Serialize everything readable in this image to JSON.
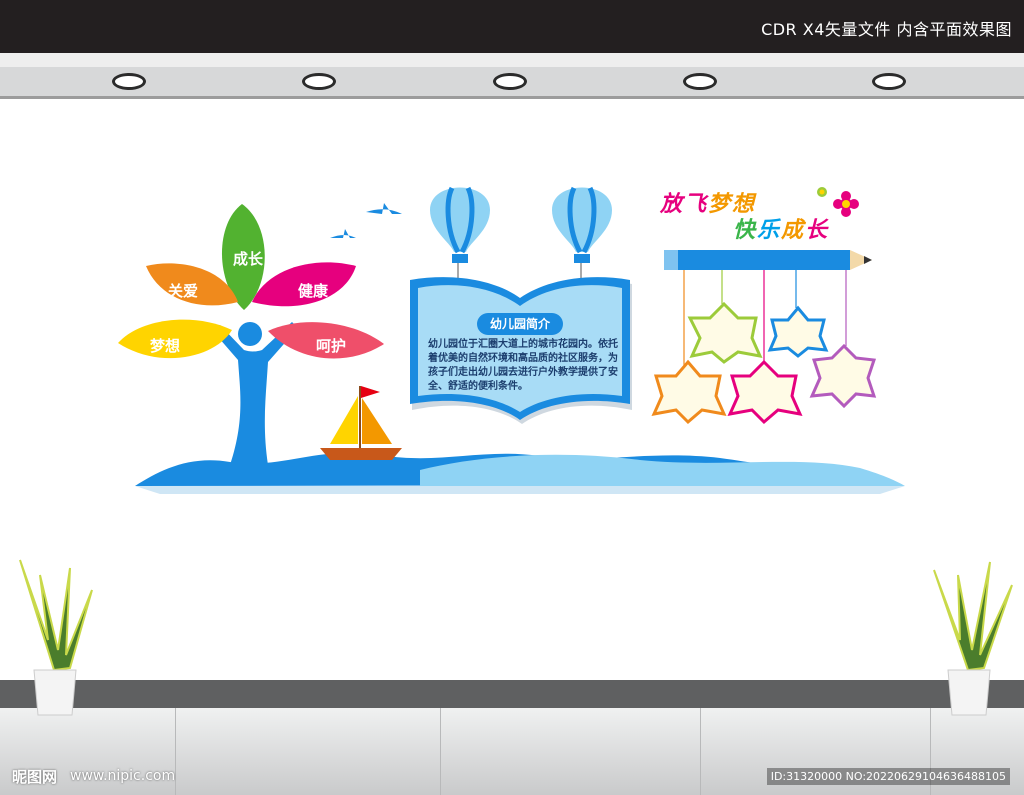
{
  "header": {
    "caption": "CDR X4矢量文件  内含平面效果图"
  },
  "petals": {
    "growth": "成长",
    "care": "关爱",
    "health": "健康",
    "dream": "梦想",
    "nurture": "呵护"
  },
  "intro": {
    "title": "幼儿园简介",
    "body": "幼儿园位于汇圈大道上的城市花园内。依托着优美的自然环境和高品质的社区服务，为孩子们走出幼儿园去进行户外教学提供了安全、舒适的便利条件。"
  },
  "slogan": {
    "line1": [
      "放",
      "飞",
      "梦",
      "想"
    ],
    "line2": [
      "快",
      "乐",
      "成",
      "长"
    ],
    "line1_colors": [
      "#e6007e",
      "#e6007e",
      "#f39800",
      "#f39800"
    ],
    "line2_colors": [
      "#3ab54a",
      "#00a0e9",
      "#f39800",
      "#e6007e"
    ]
  },
  "watermark": {
    "logo": "昵图网",
    "site": "www.nipic.com",
    "id": "ID:31320000 NO:20220629104636488105"
  },
  "colors": {
    "blue": "#1a8be0",
    "light_blue": "#8fd3f4",
    "wall": "#ffffff",
    "top_bar": "#231f20"
  }
}
